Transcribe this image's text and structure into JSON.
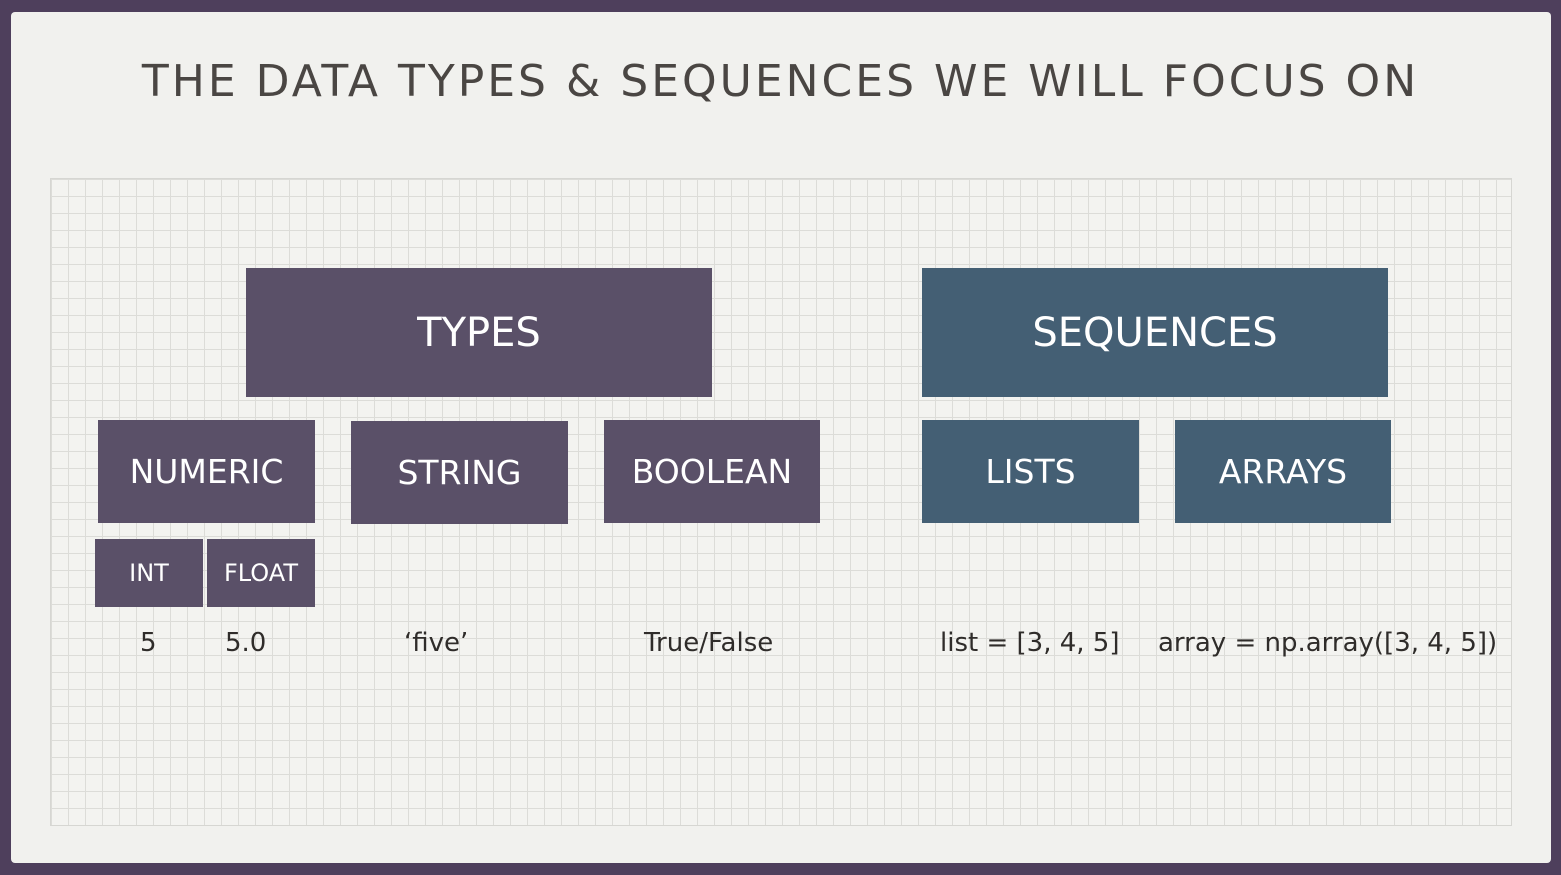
{
  "slide": {
    "title": "THE DATA TYPES & SEQUENCES WE WILL FOCUS ON"
  },
  "types": {
    "label": "TYPES",
    "numeric": "NUMERIC",
    "string": "STRING",
    "boolean": "BOOLEAN",
    "int": "INT",
    "float": "FLOAT"
  },
  "sequences": {
    "label": "SEQUENCES",
    "lists": "LISTS",
    "arrays": "ARRAYS"
  },
  "examples": {
    "int": "5",
    "float": "5.0",
    "string": "‘five’",
    "boolean": "True/False",
    "list": "list = [3, 4, 5]",
    "array": "array = np.array([3, 4, 5])"
  },
  "colors": {
    "types": "#5a5068",
    "sequences": "#445f74",
    "frame": "#4e3f5c"
  }
}
